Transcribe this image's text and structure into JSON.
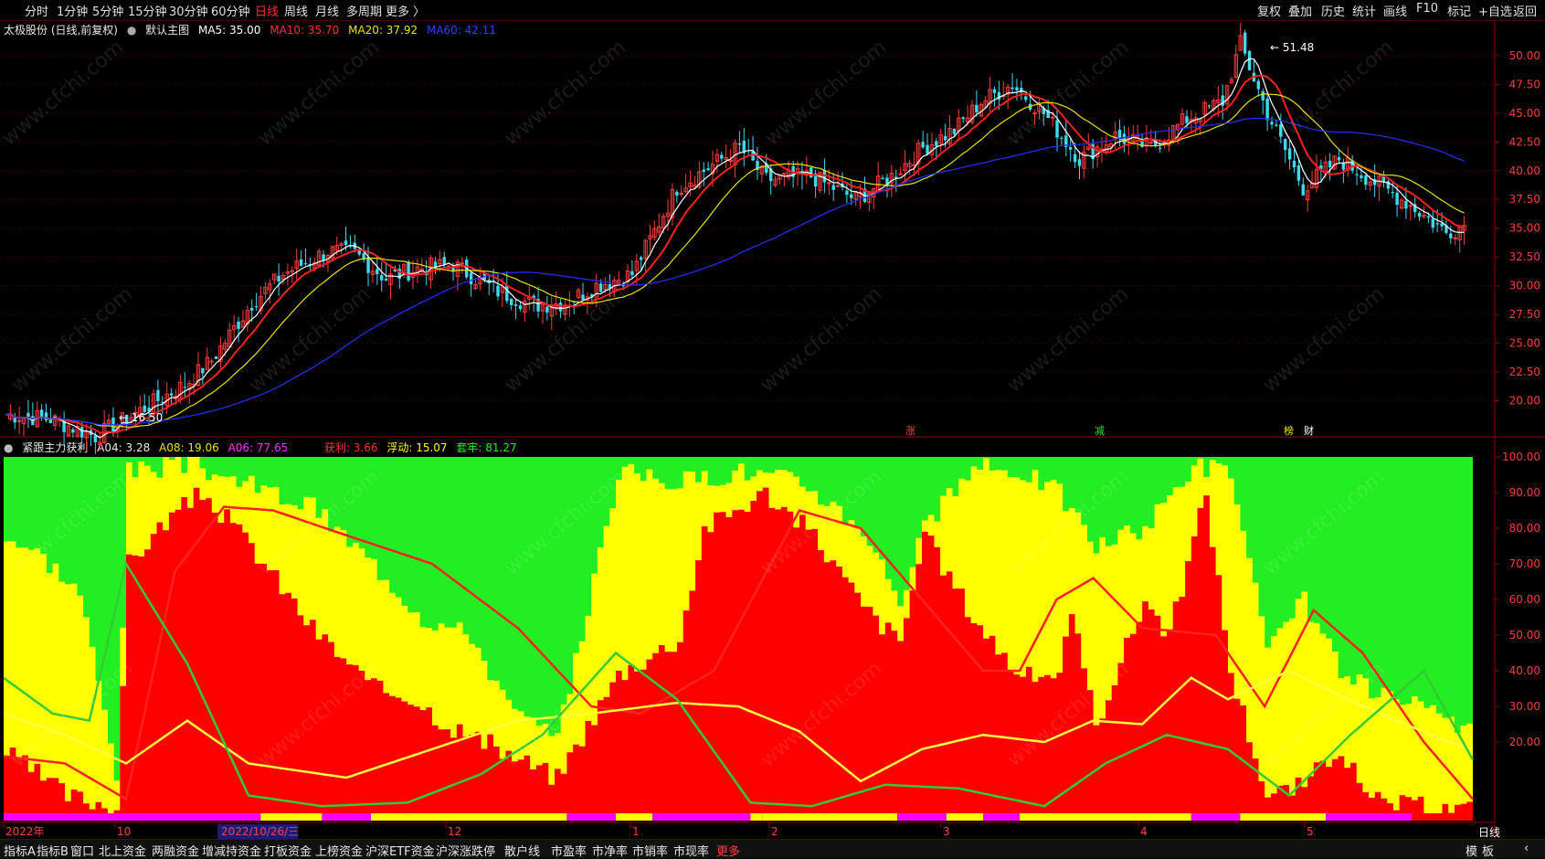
{
  "toolbar": {
    "periods": [
      {
        "label": "分时",
        "active": false
      },
      {
        "label": "1分钟",
        "active": false
      },
      {
        "label": "5分钟",
        "active": false
      },
      {
        "label": "15分钟",
        "active": false
      },
      {
        "label": "30分钟",
        "active": false
      },
      {
        "label": "60分钟",
        "active": false
      },
      {
        "label": "日线",
        "active": true
      },
      {
        "label": "周线",
        "active": false
      },
      {
        "label": "月线",
        "active": false
      },
      {
        "label": "多周期",
        "active": false
      },
      {
        "label": "更多 〉",
        "active": false
      }
    ],
    "right_buttons": [
      "复权",
      "叠加",
      "历史",
      "统计",
      "画线",
      "F10",
      "标记",
      "+自选",
      "返回"
    ]
  },
  "main_info": {
    "stock": "太极股份 (日线,前复权)",
    "template": "默认主图",
    "ma5": "MA5: 35.00",
    "ma10": "MA10: 35.70",
    "ma20": "MA20: 37.92",
    "ma60": "MA60: 42.11"
  },
  "sub_info": {
    "name": "紧跟主力获利",
    "a04": "A04: 3.28",
    "a08": "A08: 19.06",
    "a06": "A06: 77.65",
    "profit": "获利: 3.66",
    "float": "浮动: 15.07",
    "trap": "套牢: 81.27"
  },
  "colors": {
    "up": "#ff3b3b",
    "down": "#3ed8f0",
    "ma5": "#ffffff",
    "ma10": "#ff2020",
    "ma20": "#e8e000",
    "ma60": "#2030ff",
    "green": "#22ee22",
    "yellow": "#ffff00",
    "red": "#ff0000",
    "magenta": "#ff00ff",
    "axis": "#8b0000"
  },
  "chart_data": [
    {
      "type": "candlestick",
      "title": "太极股份 (日线,前复权)",
      "ylim": [
        17.5,
        51.5
      ],
      "y_ticks": [
        "50.00",
        "47.50",
        "45.00",
        "42.50",
        "40.00",
        "37.50",
        "35.00",
        "32.50",
        "30.00",
        "27.50",
        "25.00",
        "22.50",
        "20.00"
      ],
      "max_label": "51.48",
      "min_label": "16.50",
      "markers": [
        "涨",
        "减",
        "榜",
        "财"
      ],
      "series": [
        {
          "name": "MA5",
          "last": 35.0
        },
        {
          "name": "MA10",
          "last": 35.7
        },
        {
          "name": "MA20",
          "last": 37.92
        },
        {
          "name": "MA60",
          "last": 42.11
        }
      ]
    },
    {
      "type": "area",
      "title": "紧跟主力获利",
      "ylim": [
        0,
        100
      ],
      "y_ticks": [
        "100.00",
        "90.00",
        "80.00",
        "70.00",
        "60.00",
        "50.00",
        "40.00",
        "30.00",
        "20.00"
      ],
      "series": [
        {
          "name": "获利",
          "last": 3.66
        },
        {
          "name": "浮动",
          "last": 15.07
        },
        {
          "name": "套牢",
          "last": 81.27
        },
        {
          "name": "A04",
          "last": 3.28
        },
        {
          "name": "A08",
          "last": 19.06
        },
        {
          "name": "A06",
          "last": 77.65
        }
      ]
    }
  ],
  "x_axis": {
    "labels": [
      "2022年",
      "10",
      "2022/10/26/三",
      "12",
      "1",
      "2",
      "3",
      "4",
      "5"
    ],
    "right_label": "日线"
  },
  "bottom_bar": {
    "tabs": [
      "指标A",
      "指标B",
      "窗口",
      "北上资金",
      "两融资金",
      "增减持资金",
      "打板资金",
      "上榜资金",
      "沪深ETF资金",
      "沪深涨跌停",
      "散户线",
      "市盈率",
      "市净率",
      "市销率",
      "市现率",
      "更多"
    ],
    "right": [
      "模",
      "板",
      "‹"
    ]
  },
  "watermark": "www.cfchi.com"
}
